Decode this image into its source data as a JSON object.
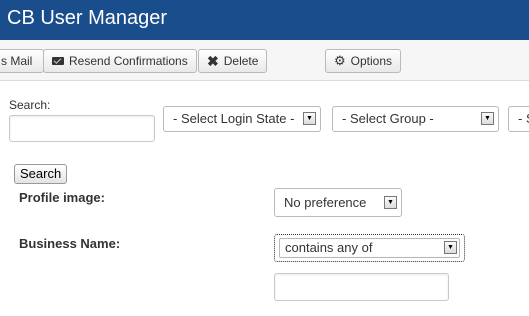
{
  "header": {
    "title": "CB User Manager"
  },
  "toolbar": {
    "mail_label": "s Mail",
    "resend_label": "Resend Confirmations",
    "delete_label": "Delete",
    "options_label": "Options"
  },
  "filters": {
    "search_label": "Search:",
    "search_value": "",
    "login_state_select": "- Select Login State -",
    "group_select": "- Select Group -",
    "cut_select": "- S"
  },
  "search_button": "Search",
  "fields": {
    "profile_image_label": "Profile image:",
    "profile_image_value": "No preference",
    "business_name_label": "Business Name:",
    "business_name_mode": "contains any of",
    "business_name_value": ""
  },
  "colors": {
    "header_bg": "#1a4d8c"
  }
}
